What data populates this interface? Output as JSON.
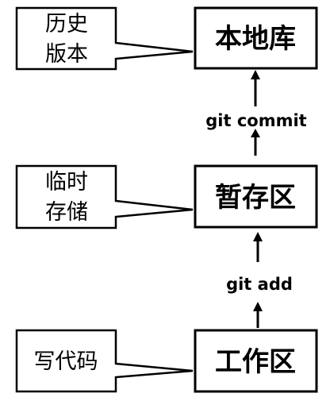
{
  "stages": {
    "local_repo": "本地库",
    "staging_area": "暂存区",
    "working_area": "工作区"
  },
  "notes": {
    "history_line1": "历史",
    "history_line2": "版本",
    "temp_line1": "临时",
    "temp_line2": "存储",
    "write_code": "写代码"
  },
  "commands": {
    "commit": "git commit",
    "add": "git add"
  },
  "colors": {
    "stroke": "#000000",
    "fill": "#ffffff"
  }
}
